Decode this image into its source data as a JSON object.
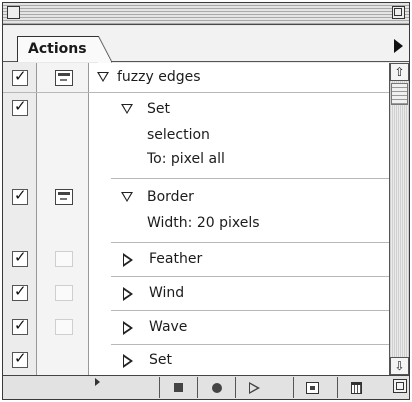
{
  "panel": {
    "tab_label": "Actions"
  },
  "rows": [
    {
      "kind": "action",
      "label": "fuzzy edges",
      "checked": true,
      "dialog": true,
      "expanded": true
    },
    {
      "kind": "command",
      "label": "Set",
      "checked": true,
      "dialog": false,
      "expanded": true,
      "details": [
        "selection",
        "To: pixel all"
      ]
    },
    {
      "kind": "command",
      "label": "Border",
      "checked": true,
      "dialog": true,
      "expanded": true,
      "details": [
        "Width: 20 pixels"
      ]
    },
    {
      "kind": "command",
      "label": "Feather",
      "checked": true,
      "dialog": false,
      "expanded": false
    },
    {
      "kind": "command",
      "label": "Wind",
      "checked": true,
      "dialog": false,
      "expanded": false
    },
    {
      "kind": "command",
      "label": "Wave",
      "checked": true,
      "dialog": false,
      "expanded": false
    },
    {
      "kind": "command",
      "label": "Set",
      "checked": true,
      "dialog": false,
      "expanded": false
    }
  ],
  "toolbar": {
    "buttons": [
      "stop-icon",
      "record-icon",
      "play-icon",
      "new-set-icon",
      "trash-icon"
    ]
  },
  "icons": {
    "checkmark": "checkmark-icon",
    "dialog_toggle": "dialog-icon",
    "expand": "triangle-down-icon",
    "collapse": "triangle-right-icon",
    "palette_menu": "palette-menu-arrow-icon",
    "scroll_up": "scroll-up-arrow-icon",
    "scroll_down": "scroll-down-arrow-icon"
  }
}
